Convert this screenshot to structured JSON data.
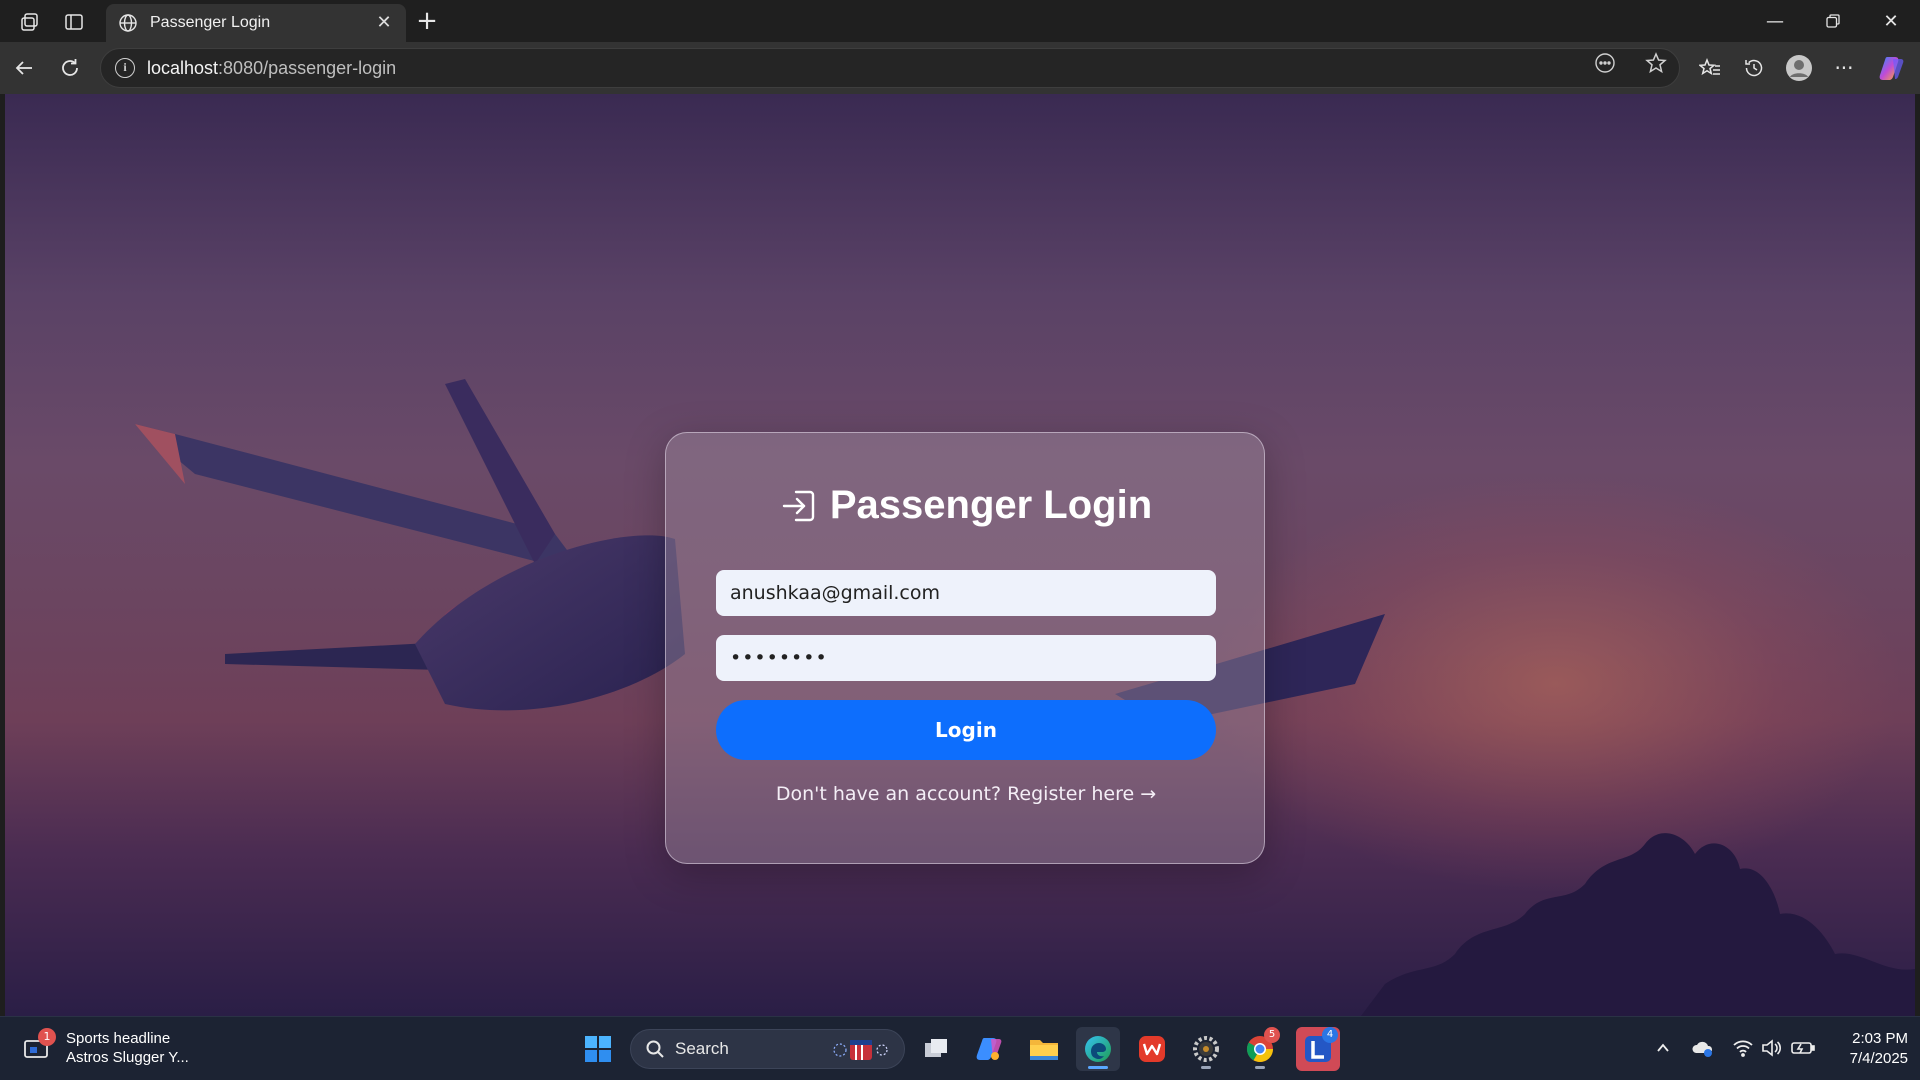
{
  "browser": {
    "tab_title": "Passenger Login",
    "url_host": "localhost",
    "url_rest": ":8080/passenger-login"
  },
  "login": {
    "title": "Passenger Login",
    "email_value": "anushkaa@gmail.com",
    "password_value": "••••••••",
    "button_label": "Login",
    "register_text": "Don't have an account? Register here →"
  },
  "taskbar": {
    "widget_title": "Sports headline",
    "widget_subtitle": "Astros Slugger Y...",
    "widget_badge": "1",
    "search_label": "Search",
    "chrome_badge": "5",
    "app_badge": "4",
    "time": "2:03 PM",
    "date": "7/4/2025"
  },
  "colors": {
    "accent": "#0d6efd",
    "tabbar": "#1f1f1f",
    "navbar": "#333333",
    "taskbar": "#1c2333"
  },
  "icons": [
    "workspaces-icon",
    "tab-actions-icon",
    "globe-icon",
    "close-icon",
    "new-tab-icon",
    "minimize-icon",
    "restore-icon",
    "window-close-icon",
    "back-icon",
    "refresh-icon",
    "info-icon",
    "reading-icon",
    "favorite-star-icon",
    "favorites-icon",
    "history-icon",
    "profile-icon",
    "more-icon",
    "copilot-icon",
    "login-icon",
    "windows-start-icon",
    "search-icon",
    "task-view-icon",
    "file-explorer-icon",
    "edge-icon",
    "chrome-icon"
  ]
}
